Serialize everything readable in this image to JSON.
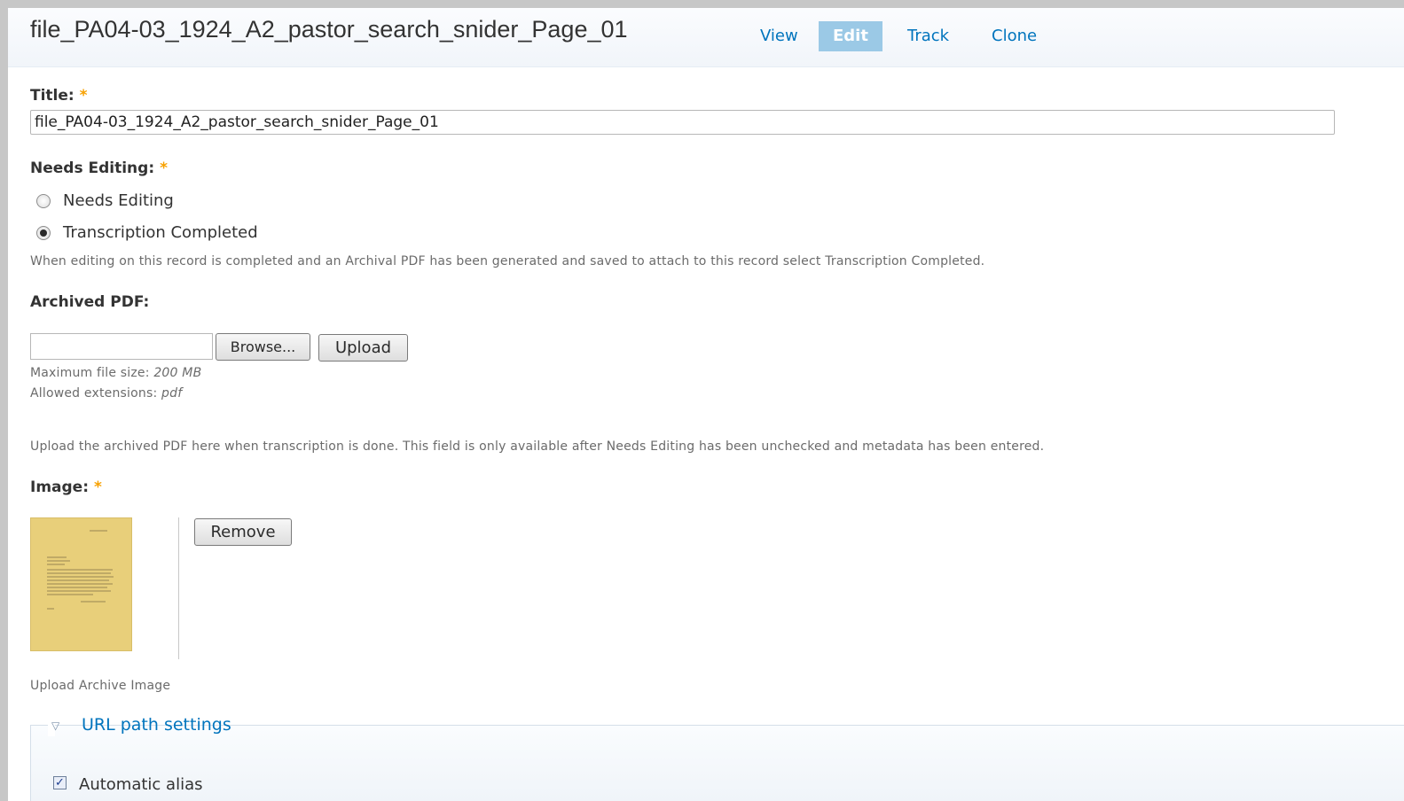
{
  "header": {
    "title": "file_PA04-03_1924_A2_pastor_search_snider_Page_01",
    "tabs": [
      {
        "label": "View",
        "active": false
      },
      {
        "label": "Edit",
        "active": true
      },
      {
        "label": "Track",
        "active": false
      },
      {
        "label": "Clone",
        "active": false
      }
    ]
  },
  "form": {
    "title_field": {
      "label": "Title:",
      "required_mark": "*",
      "value": "file_PA04-03_1924_A2_pastor_search_snider_Page_01"
    },
    "needs_editing": {
      "label": "Needs Editing:",
      "required_mark": "*",
      "options": [
        {
          "label": "Needs Editing",
          "checked": false
        },
        {
          "label": "Transcription Completed",
          "checked": true
        }
      ],
      "description": "When editing on this record is completed and an Archival PDF has been generated and saved to attach to this record select Transcription Completed."
    },
    "archived_pdf": {
      "label": "Archived PDF:",
      "browse_label": "Browse...",
      "upload_label": "Upload",
      "max_size_label": "Maximum file size:",
      "max_size_value": "200 MB",
      "extensions_label": "Allowed extensions:",
      "extensions_value": "pdf",
      "description": "Upload the archived PDF here when transcription is done. This field is only available after Needs Editing has been unchecked and metadata has been entered."
    },
    "image": {
      "label": "Image:",
      "required_mark": "*",
      "remove_label": "Remove",
      "description": "Upload Archive Image"
    },
    "url_path": {
      "legend": "URL path settings",
      "automatic_alias_label": "Automatic alias",
      "automatic_alias_checked": true
    }
  },
  "colors": {
    "link": "#0074bd",
    "active_tab_bg": "#9bc9e6",
    "required": "#f7a100",
    "thumbnail_paper": "#e8cf7a"
  }
}
